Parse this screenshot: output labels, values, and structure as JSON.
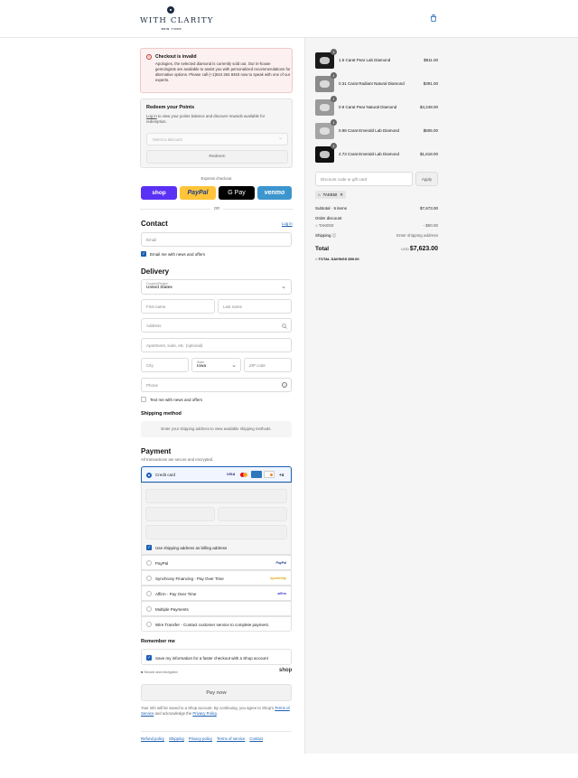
{
  "header": {
    "brand_name": "WITH CLARITY",
    "brand_city": "NEW YORK",
    "cart_icon": "shopping-bag-icon"
  },
  "alert": {
    "icon": "alert-circle-icon",
    "title": "Checkout is invalid",
    "body": "Apologies, the selected diamond is currently sold out. Our in-house gemologists are available to assist you with personalized recommendations for alternative options. Please call (+1)844 254 8463 now to speak with one of our experts."
  },
  "points": {
    "title": "Redeem your Points",
    "login_link": "Log in",
    "body_rest": " to view your points balance and discover rewards available for redemption.",
    "select_placeholder": "Select a discount",
    "redeem_label": "Redeem"
  },
  "express": {
    "label": "Express checkout",
    "shop": "shop",
    "paypal": "PayPal",
    "gpay": "G Pay",
    "venmo": "venmo",
    "or": "OR"
  },
  "contact": {
    "title": "Contact",
    "login": "Log in",
    "email_placeholder": "Email",
    "news_label": "Email me with news and offers"
  },
  "delivery": {
    "title": "Delivery",
    "country_label": "Country/Region",
    "country_value": "United States",
    "first_name": "First name",
    "last_name": "Last name",
    "address": "Address",
    "apartment": "Apartment, suite, etc. (optional)",
    "city": "City",
    "state_label": "State",
    "state_value": "Iowa",
    "zip": "ZIP code",
    "phone": "Phone",
    "text_label": "Text me with news and offers"
  },
  "shipping": {
    "title": "Shipping method",
    "notice": "Enter your shipping address to view available shipping methods."
  },
  "payment": {
    "title": "Payment",
    "subtitle": "All transactions are secure and encrypted.",
    "credit_card": "Credit card",
    "card_more": "+4",
    "billing_label": "Use shipping address as billing address",
    "options": [
      {
        "label": "PayPal",
        "logo": "PayPal"
      },
      {
        "label": "Synchrony Financing - Pay Over Time",
        "logo": "synchrony"
      },
      {
        "label": "Affirm - Pay Over Time",
        "logo": "affirm"
      },
      {
        "label": "Multiple Payments",
        "logo": ""
      },
      {
        "label": "Wire Transfer - Contact customer service to complete payment.",
        "logo": ""
      }
    ]
  },
  "remember": {
    "title": "Remember me",
    "save_label": "Save my information for a faster checkout with a Shop account",
    "secure": "Secure and encrypted",
    "shop_logo": "shop"
  },
  "pay_now": "Pay now",
  "legal": {
    "text1": "Your info will be saved to a Shop account. By continuing, you agree to Shop's ",
    "terms": "Terms of Service",
    "text2": " and acknowledge the ",
    "privacy": "Privacy Policy",
    "text3": "."
  },
  "footer_links": [
    "Refund policy",
    "Shipping",
    "Privacy policy",
    "Terms of service",
    "Contact"
  ],
  "summary": {
    "items": [
      {
        "qty": "1",
        "name": "1.5 Carat Pear Lab Diamond",
        "price": "$811.00"
      },
      {
        "qty": "1",
        "name": "0.31 Carat Radiant Natural Diamond",
        "price": "$391.00"
      },
      {
        "qty": "1",
        "name": "0.9 Carat Pear Natural Diamond",
        "price": "$4,248.00"
      },
      {
        "qty": "1",
        "name": "0.98 Carat Emerald Lab Diamond",
        "price": "$605.00"
      },
      {
        "qty": "1",
        "name": "2.73 Carat Emerald Lab Diamond",
        "price": "$1,618.00"
      }
    ],
    "discount_placeholder": "Discount code or gift card",
    "apply_label": "Apply",
    "code_tag": "TAKE50",
    "subtotal_label": "Subtotal · 5 items",
    "subtotal_value": "$7,673.00",
    "order_discount_label": "Order discount",
    "order_discount_code": "TAKE50",
    "order_discount_value": "- $50.00",
    "shipping_label": "Shipping",
    "shipping_value": "Enter shipping address",
    "total_label": "Total",
    "currency": "USD",
    "total_value": "$7,623.00",
    "savings_label": "TOTAL SAVINGS",
    "savings_value": "$50.00"
  }
}
